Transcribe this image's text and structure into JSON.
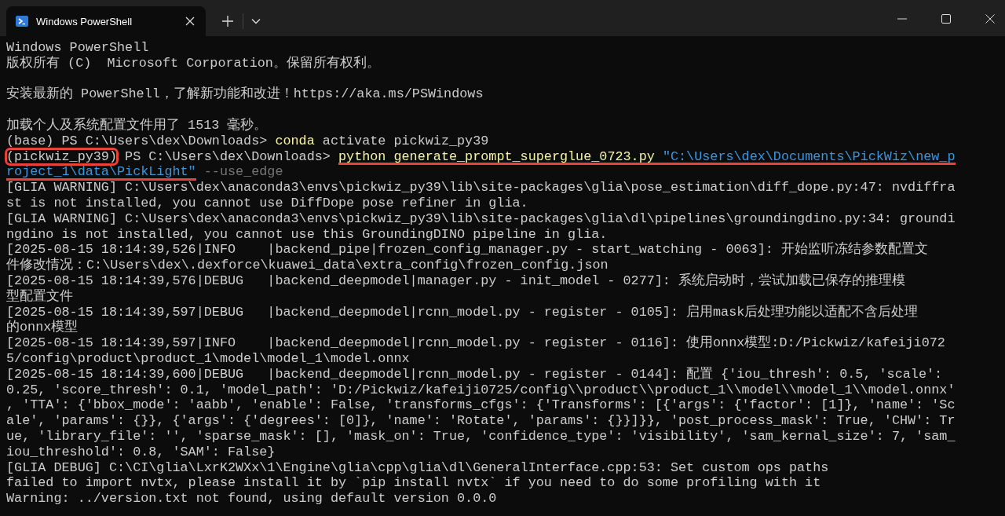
{
  "tabs": [
    {
      "title": "Windows PowerShell",
      "selected": true
    }
  ],
  "lines": [
    {
      "segments": [
        {
          "text": "Windows PowerShell",
          "kind": "plain"
        }
      ]
    },
    {
      "segments": [
        {
          "text": "版权所有 (C)  Microsoft Corporation。保留所有权利。",
          "kind": "plain"
        }
      ]
    },
    {
      "spaced": true,
      "segments": [
        {
          "text": "安装最新的 PowerShell，了解新功能和改进！https://aka.ms/PSWindows",
          "kind": "plain"
        }
      ]
    },
    {
      "spaced": true,
      "segments": [
        {
          "text": "加载个人及系统配置文件用了 1513 毫秒。",
          "kind": "plain"
        }
      ]
    },
    {
      "segments": [
        {
          "text": "(base) PS C:\\Users\\dex\\Downloads> ",
          "kind": "plain"
        },
        {
          "text": "conda",
          "kind": "command"
        },
        {
          "text": " activate pickwiz_py39",
          "kind": "plain"
        }
      ]
    },
    {
      "segments": [
        {
          "text": "(pickwiz_py39)",
          "kind": "plain",
          "boxed": true
        },
        {
          "text": " PS C:\\Users\\dex\\Downloads> ",
          "kind": "plain"
        },
        {
          "text": "python generate_prompt_superglue_0723.py",
          "kind": "command",
          "underlined": true
        },
        {
          "text": " \"C:\\Users\\dex\\Documents\\PickWiz\\new_p",
          "kind": "string",
          "underlined": true
        }
      ]
    },
    {
      "segments": [
        {
          "text": "roject_1\\data\\PickLight\"",
          "kind": "string",
          "underlined": true
        },
        {
          "text": " --use_edge",
          "kind": "option"
        }
      ]
    },
    {
      "segments": [
        {
          "text": "[GLIA WARNING] C:\\Users\\dex\\anaconda3\\envs\\pickwiz_py39\\lib\\site-packages\\glia\\pose_estimation\\diff_dope.py:47: nvdiffra",
          "kind": "plain"
        }
      ]
    },
    {
      "segments": [
        {
          "text": "st is not installed, you cannot use DiffDope pose refiner in glia.",
          "kind": "plain"
        }
      ]
    },
    {
      "segments": [
        {
          "text": "[GLIA WARNING] C:\\Users\\dex\\anaconda3\\envs\\pickwiz_py39\\lib\\site-packages\\glia\\dl\\pipelines\\groundingdino.py:34: groundi",
          "kind": "plain"
        }
      ]
    },
    {
      "segments": [
        {
          "text": "ngdino is not installed, you cannot use this GroundingDINO pipeline in glia.",
          "kind": "plain"
        }
      ]
    },
    {
      "segments": [
        {
          "text": "[2025-08-15 18:14:39,526|INFO    |backend_pipe|frozen_config_manager.py - start_watching - 0063]: 开始监听冻结参数配置文",
          "kind": "plain"
        }
      ]
    },
    {
      "segments": [
        {
          "text": "件修改情况：C:\\Users\\dex\\.dexforce\\kuawei_data\\extra_config\\frozen_config.json",
          "kind": "plain"
        }
      ]
    },
    {
      "segments": [
        {
          "text": "[2025-08-15 18:14:39,576|DEBUG   |backend_deepmodel|manager.py - init_model - 0277]: 系统启动时，尝试加载已保存的推理模",
          "kind": "plain"
        }
      ]
    },
    {
      "segments": [
        {
          "text": "型配置文件",
          "kind": "plain"
        }
      ]
    },
    {
      "segments": [
        {
          "text": "[2025-08-15 18:14:39,597|DEBUG   |backend_deepmodel|rcnn_model.py - register - 0105]: 启用mask后处理功能以适配不含后处理",
          "kind": "plain"
        }
      ]
    },
    {
      "segments": [
        {
          "text": "的onnx模型",
          "kind": "plain"
        }
      ]
    },
    {
      "segments": [
        {
          "text": "[2025-08-15 18:14:39,597|INFO    |backend_deepmodel|rcnn_model.py - register - 0116]: 使用onnx模型:D:/Pickwiz/kafeiji072",
          "kind": "plain"
        }
      ]
    },
    {
      "segments": [
        {
          "text": "5/config\\product\\product_1\\model\\model_1\\model.onnx",
          "kind": "plain"
        }
      ]
    },
    {
      "segments": [
        {
          "text": "[2025-08-15 18:14:39,600|DEBUG   |backend_deepmodel|rcnn_model.py - register - 0144]: 配置 {'iou_thresh': 0.5, 'scale':",
          "kind": "plain"
        }
      ]
    },
    {
      "segments": [
        {
          "text": "0.25, 'score_thresh': 0.1, 'model_path': 'D:/Pickwiz/kafeiji0725/config\\\\product\\\\product_1\\\\model\\\\model_1\\\\model.onnx'",
          "kind": "plain"
        }
      ]
    },
    {
      "segments": [
        {
          "text": ", 'TTA': {'bbox_mode': 'aabb', 'enable': False, 'transforms_cfgs': {'Transforms': [{'args': {'factor': [1]}, 'name': 'Sc",
          "kind": "plain"
        }
      ]
    },
    {
      "segments": [
        {
          "text": "ale', 'params': {}}, {'args': {'degrees': [0]}, 'name': 'Rotate', 'params': {}}]}}, 'post_process_mask': True, 'CHW': Tr",
          "kind": "plain"
        }
      ]
    },
    {
      "segments": [
        {
          "text": "ue, 'library_file': '', 'sparse_mask': [], 'mask_on': True, 'confidence_type': 'visibility', 'sam_kernal_size': 7, 'sam_",
          "kind": "plain"
        }
      ]
    },
    {
      "segments": [
        {
          "text": "iou_threshold': 0.8, 'SAM': False}",
          "kind": "plain"
        }
      ]
    },
    {
      "segments": [
        {
          "text": "[GLIA DEBUG] C:\\CI\\glia\\LxrK2WXx\\1\\Engine\\glia\\cpp\\glia\\dl\\GeneralInterface.cpp:53: Set custom ops paths",
          "kind": "plain"
        }
      ]
    },
    {
      "segments": [
        {
          "text": "failed to import nvtx, please install it by `pip install nvtx` if you need to do some profiling with it",
          "kind": "plain"
        }
      ]
    },
    {
      "segments": [
        {
          "text": "Warning: ../version.txt not found, using default version 0.0.0",
          "kind": "plain"
        }
      ]
    }
  ]
}
